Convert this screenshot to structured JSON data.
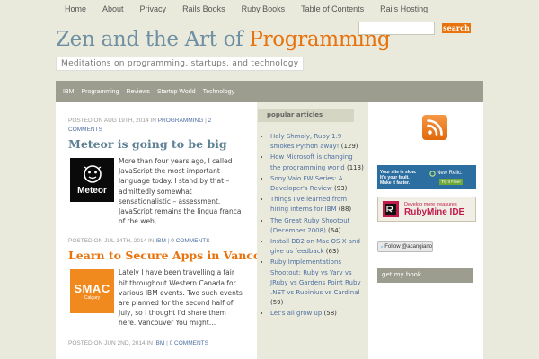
{
  "topnav": [
    "Home",
    "About",
    "Privacy",
    "Rails Books",
    "Ruby Books",
    "Table of Contents",
    "Rails Hosting"
  ],
  "site": {
    "title_main": "Zen and the Art of",
    "title_accent": "Programming",
    "tagline": "Meditations on programming, startups, and technology"
  },
  "search": {
    "button": "search",
    "value": ""
  },
  "catnav": [
    "IBM",
    "Programming",
    "Reviews",
    "Startup World",
    "Technology"
  ],
  "posts": [
    {
      "meta_prefix": "Posted on Aug 19th, 2014 in",
      "category": "Programming",
      "comments": "2 Comments",
      "title": "Meteor is going to be big",
      "thumb_label": "Meteor",
      "excerpt": "More than four years ago, I called JavaScript the most important language today. I stand by that – admittedly somewhat sensationalistic – assessment. JavaScript remains the lingua franca of the web,…"
    },
    {
      "meta_prefix": "Posted on Jul 14th, 2014 in",
      "category": "IBM",
      "comments": "0 Comments",
      "title": "Learn to Secure Apps in Vancouver, a…",
      "thumb_label": "SMAC",
      "thumb_sublabel": "Calgary",
      "excerpt": "Lately I have been travelling a fair bit throughout Western Canada for various IBM events. Two such events are planned for the second half of July, so I thought I'd share them here. Vancouver You might…"
    },
    {
      "meta_prefix": "Posted on Jun 2nd, 2014 in",
      "category": "IBM",
      "comments": "0 Comments"
    }
  ],
  "popular": {
    "heading": "popular articles",
    "items": [
      {
        "title": "Holy Shmoly, Ruby 1.9 smokes Python away!",
        "count": "(129)"
      },
      {
        "title": "How Microsoft is changing the programming world",
        "count": "(113)"
      },
      {
        "title": "Sony Vaio FW Series: A Developer's Review",
        "count": "(93)"
      },
      {
        "title": "Things I've learned from hiring interns for IBM",
        "count": "(88)"
      },
      {
        "title": "The Great Ruby Shootout (December 2008)",
        "count": "(64)"
      },
      {
        "title": "Install DB2 on Mac OS X and give us feedback",
        "count": "(63)"
      },
      {
        "title": "Ruby Implementations Shootout: Ruby vs Yarv vs JRuby vs Gardens Point Ruby .NET vs Rubinius vs Cardinal",
        "count": "(59)"
      },
      {
        "title": "Let's all grow up",
        "count": "(58)"
      }
    ]
  },
  "ads": {
    "newrelic": {
      "line1": "Your site is slow.",
      "line2": "It's your fault.",
      "line3": "Make it faster.",
      "brand": "New Relic.",
      "cta": "Try it Free!"
    },
    "rubymine": {
      "line1": "Develop more treasures",
      "brand": "RubyMine IDE"
    }
  },
  "follow": {
    "label": "Follow @acangiano"
  },
  "getbook": {
    "heading": "get my book"
  },
  "colors": {
    "accent": "#e8720c",
    "title_blue": "#6f8fa3",
    "link": "#4d6fa0",
    "catnav_bg": "#9c9d8e"
  }
}
